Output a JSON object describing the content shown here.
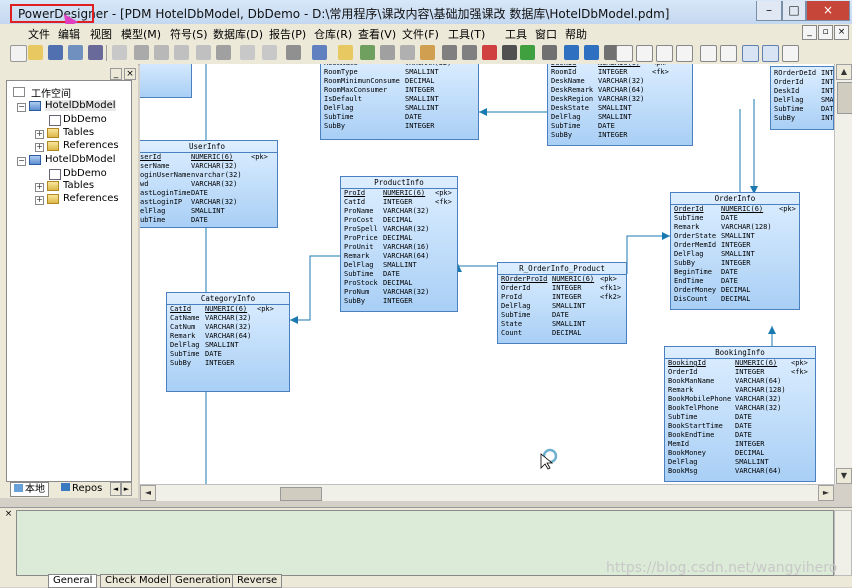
{
  "window": {
    "app_name": "PowerDesigner",
    "title_rest": " - [PDM HotelDbModel, DbDemo - D:\\常用程序\\课改内容\\基础加强课改 数据库\\HotelDbModel.pdm]",
    "minimize": "–",
    "maximize": "□",
    "close": "×",
    "doc_minimize": "_",
    "doc_restore": "▫",
    "doc_close": "×"
  },
  "menu": [
    "文件",
    "编辑",
    "视图",
    "模型(M)",
    "符号(S)",
    "数据库(D)",
    "报告(P)",
    "仓库(R)",
    "查看(V)",
    "文件(F)",
    "工具(T)",
    "工具",
    "窗口",
    "帮助"
  ],
  "workspace": {
    "label": "工作空间",
    "items": [
      {
        "label": "HotelDbModel",
        "level": 1
      },
      {
        "label": "DbDemo",
        "level": 2
      },
      {
        "label": "Tables",
        "level": 2
      },
      {
        "label": "References",
        "level": 2
      },
      {
        "label": "HotelDbModel",
        "level": 1
      },
      {
        "label": "DbDemo",
        "level": 2
      },
      {
        "label": "Tables",
        "level": 2
      },
      {
        "label": "References",
        "level": 2
      }
    ],
    "tabs": [
      "本地",
      "Repos"
    ]
  },
  "tables": {
    "roominfo": {
      "title": "",
      "rows": [
        [
          "RoomName",
          "VARCHAR(32)",
          ""
        ],
        [
          "RoomType",
          "SMALLINT",
          ""
        ],
        [
          "RoomMinimunConsume",
          "DECIMAL",
          ""
        ],
        [
          "RoomMaxConsumer",
          "INTEGER",
          ""
        ],
        [
          "IsDefault",
          "SMALLINT",
          ""
        ],
        [
          "DelFlag",
          "SMALLINT",
          ""
        ],
        [
          "SubTime",
          "DATE",
          ""
        ],
        [
          "SubBy",
          "INTEGER",
          ""
        ]
      ]
    },
    "desk": {
      "title": "",
      "rows": [
        [
          "DeskId",
          "NUMERIC(6)",
          "<pk>"
        ],
        [
          "RoomId",
          "INTEGER",
          "<fk>"
        ],
        [
          "DeskName",
          "VARCHAR(32)",
          ""
        ],
        [
          "DeskRemark",
          "VARCHAR(64)",
          ""
        ],
        [
          "DeskRegion",
          "VARCHAR(32)",
          ""
        ],
        [
          "DeskState",
          "SMALLINT",
          ""
        ],
        [
          "DelFlag",
          "SMALLINT",
          ""
        ],
        [
          "SubTime",
          "DATE",
          ""
        ],
        [
          "SubBy",
          "INTEGER",
          ""
        ]
      ]
    },
    "rorderdesk": {
      "title": "",
      "rows": [
        [
          "ROrderDeId",
          "INTE",
          ""
        ],
        [
          "OrderId",
          "INTE",
          ""
        ],
        [
          "DeskId",
          "INTE",
          ""
        ],
        [
          "DelFlag",
          "SMAL",
          ""
        ],
        [
          "SubTime",
          "DATE",
          ""
        ],
        [
          "SubBy",
          "INTE",
          ""
        ]
      ]
    },
    "userinfo": {
      "title": "UserInfo",
      "rows": [
        [
          "serId",
          "NUMERIC(6)",
          "<pk>"
        ],
        [
          "serName",
          "VARCHAR(32)",
          ""
        ],
        [
          "oginUserName",
          "nvarchar(32)",
          ""
        ],
        [
          "wd",
          "VARCHAR(32)",
          ""
        ],
        [
          "astLoginTime",
          "DATE",
          ""
        ],
        [
          "astLoginIP",
          "VARCHAR(32)",
          ""
        ],
        [
          "elFlag",
          "SMALLINT",
          ""
        ],
        [
          "ubTime",
          "DATE",
          ""
        ]
      ]
    },
    "productinfo": {
      "title": "ProductInfo",
      "rows": [
        [
          "ProId",
          "NUMERIC(6)",
          "<pk>"
        ],
        [
          "CatId",
          "INTEGER",
          "<fk>"
        ],
        [
          "ProName",
          "VARCHAR(32)",
          ""
        ],
        [
          "ProCost",
          "DECIMAL",
          ""
        ],
        [
          "ProSpell",
          "VARCHAR(32)",
          ""
        ],
        [
          "ProPrice",
          "DECIMAL",
          ""
        ],
        [
          "ProUnit",
          "VARCHAR(16)",
          ""
        ],
        [
          "Remark",
          "VARCHAR(64)",
          ""
        ],
        [
          "DelFlag",
          "SMALLINT",
          ""
        ],
        [
          "SubTime",
          "DATE",
          ""
        ],
        [
          "ProStock",
          "DECIMAL",
          ""
        ],
        [
          "ProNum",
          "VARCHAR(32)",
          ""
        ],
        [
          "SubBy",
          "INTEGER",
          ""
        ]
      ]
    },
    "orderinfo": {
      "title": "OrderInfo",
      "rows": [
        [
          "OrderId",
          "NUMERIC(6)",
          "<pk>"
        ],
        [
          "SubTime",
          "DATE",
          ""
        ],
        [
          "Remark",
          "VARCHAR(128)",
          ""
        ],
        [
          "OrderState",
          "SMALLINT",
          ""
        ],
        [
          "OrderMemId",
          "INTEGER",
          ""
        ],
        [
          "DelFlag",
          "SMALLINT",
          ""
        ],
        [
          "SubBy",
          "INTEGER",
          ""
        ],
        [
          "BeginTime",
          "DATE",
          ""
        ],
        [
          "EndTime",
          "DATE",
          ""
        ],
        [
          "OrderMoney",
          "DECIMAL",
          ""
        ],
        [
          "DisCount",
          "DECIMAL",
          ""
        ]
      ]
    },
    "rorderproduct": {
      "title": "R_OrderInfo_Product",
      "rows": [
        [
          "ROrderProId",
          "NUMERIC(6)",
          "<pk>"
        ],
        [
          "OrderId",
          "INTEGER",
          "<fk1>"
        ],
        [
          "ProId",
          "INTEGER",
          "<fk2>"
        ],
        [
          "DelFlag",
          "SMALLINT",
          ""
        ],
        [
          "SubTime",
          "DATE",
          ""
        ],
        [
          "State",
          "SMALLINT",
          ""
        ],
        [
          "Count",
          "DECIMAL",
          ""
        ]
      ]
    },
    "categoryinfo": {
      "title": "CategoryInfo",
      "rows": [
        [
          "CatId",
          "NUMERIC(6)",
          "<pk>"
        ],
        [
          "CatName",
          "VARCHAR(32)",
          ""
        ],
        [
          "CatNum",
          "VARCHAR(32)",
          ""
        ],
        [
          "Remark",
          "VARCHAR(64)",
          ""
        ],
        [
          "DelFlag",
          "SMALLINT",
          ""
        ],
        [
          "SubTime",
          "DATE",
          ""
        ],
        [
          "SubBy",
          "INTEGER",
          ""
        ]
      ]
    },
    "bookinginfo": {
      "title": "BookingInfo",
      "rows": [
        [
          "BookingId",
          "NUMERIC(6)",
          "<pk>"
        ],
        [
          "OrderId",
          "INTEGER",
          "<fk>"
        ],
        [
          "BookManName",
          "VARCHAR(64)",
          ""
        ],
        [
          "Remark",
          "VARCHAR(128)",
          ""
        ],
        [
          "BookMobilePhone",
          "VARCHAR(32)",
          ""
        ],
        [
          "BookTelPhone",
          "VARCHAR(32)",
          ""
        ],
        [
          "SubTime",
          "DATE",
          ""
        ],
        [
          "BookStartTime",
          "DATE",
          ""
        ],
        [
          "BookEndTime",
          "DATE",
          ""
        ],
        [
          "MemId",
          "INTEGER",
          ""
        ],
        [
          "BookMoney",
          "DECIMAL",
          ""
        ],
        [
          "DelFlag",
          "SMALLINT",
          ""
        ],
        [
          "BookMsg",
          "VARCHAR(64)",
          ""
        ]
      ]
    }
  },
  "output_tabs": [
    "General",
    "Check Model",
    "Generation",
    "Reverse"
  ],
  "watermark": "https://blog.csdn.net/wangyihero",
  "colors": {
    "accent": "#e02020",
    "table_border": "#4a80c0",
    "link": "#1a7ab0",
    "output_bg": "#dcebd7"
  }
}
